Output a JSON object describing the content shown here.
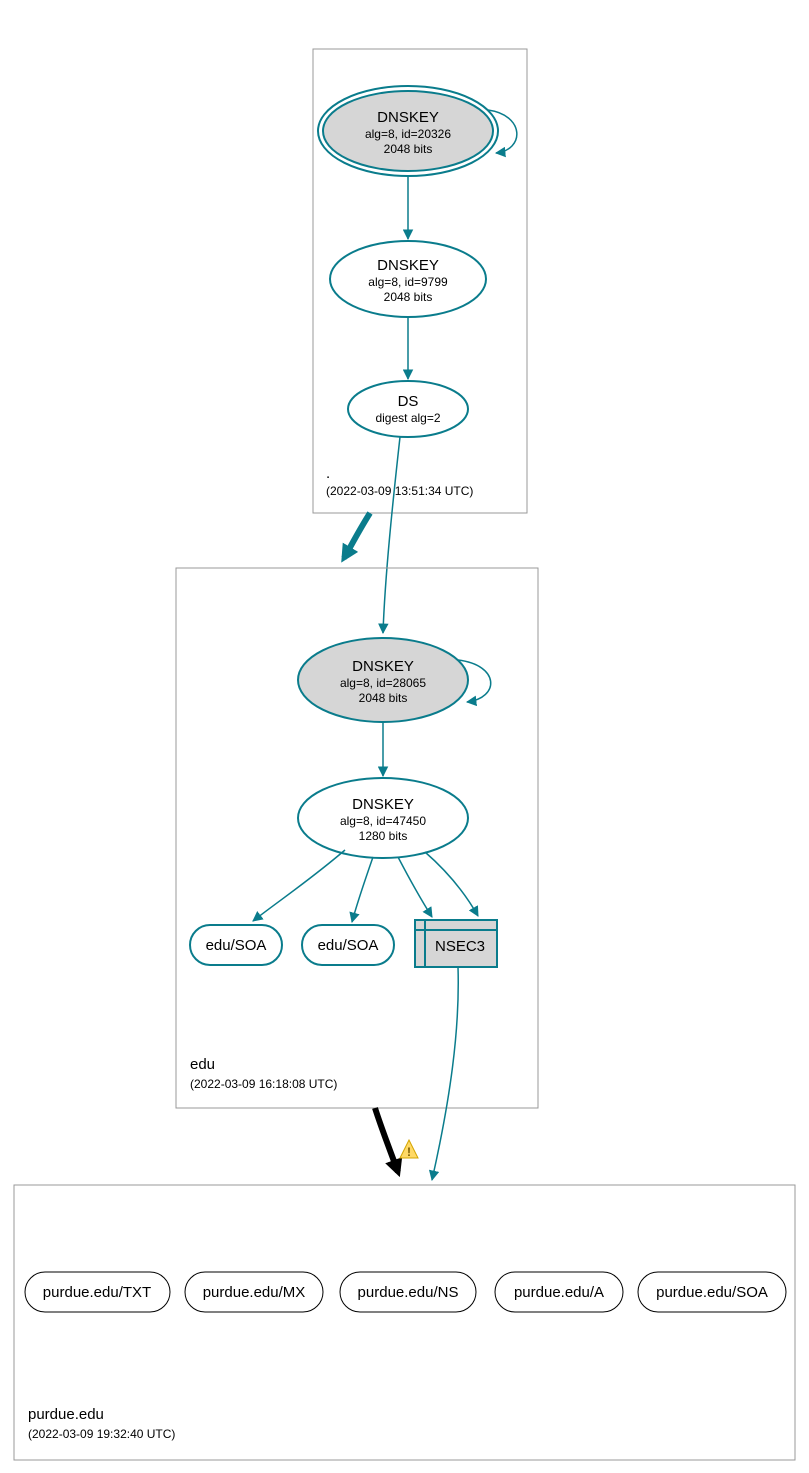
{
  "zones": {
    "root": {
      "name": ".",
      "timestamp": "(2022-03-09 13:51:34 UTC)",
      "nodes": {
        "ksk": {
          "title": "DNSKEY",
          "line2": "alg=8, id=20326",
          "line3": "2048 bits"
        },
        "zsk": {
          "title": "DNSKEY",
          "line2": "alg=8, id=9799",
          "line3": "2048 bits"
        },
        "ds": {
          "title": "DS",
          "line2": "digest alg=2"
        }
      }
    },
    "edu": {
      "name": "edu",
      "timestamp": "(2022-03-09 16:18:08 UTC)",
      "nodes": {
        "ksk": {
          "title": "DNSKEY",
          "line2": "alg=8, id=28065",
          "line3": "2048 bits"
        },
        "zsk": {
          "title": "DNSKEY",
          "line2": "alg=8, id=47450",
          "line3": "1280 bits"
        },
        "soa1": "edu/SOA",
        "soa2": "edu/SOA",
        "nsec3": "NSEC3"
      }
    },
    "purdue": {
      "name": "purdue.edu",
      "timestamp": "(2022-03-09 19:32:40 UTC)",
      "records": [
        "purdue.edu/TXT",
        "purdue.edu/MX",
        "purdue.edu/NS",
        "purdue.edu/A",
        "purdue.edu/SOA"
      ]
    }
  },
  "warning_glyph": "!"
}
